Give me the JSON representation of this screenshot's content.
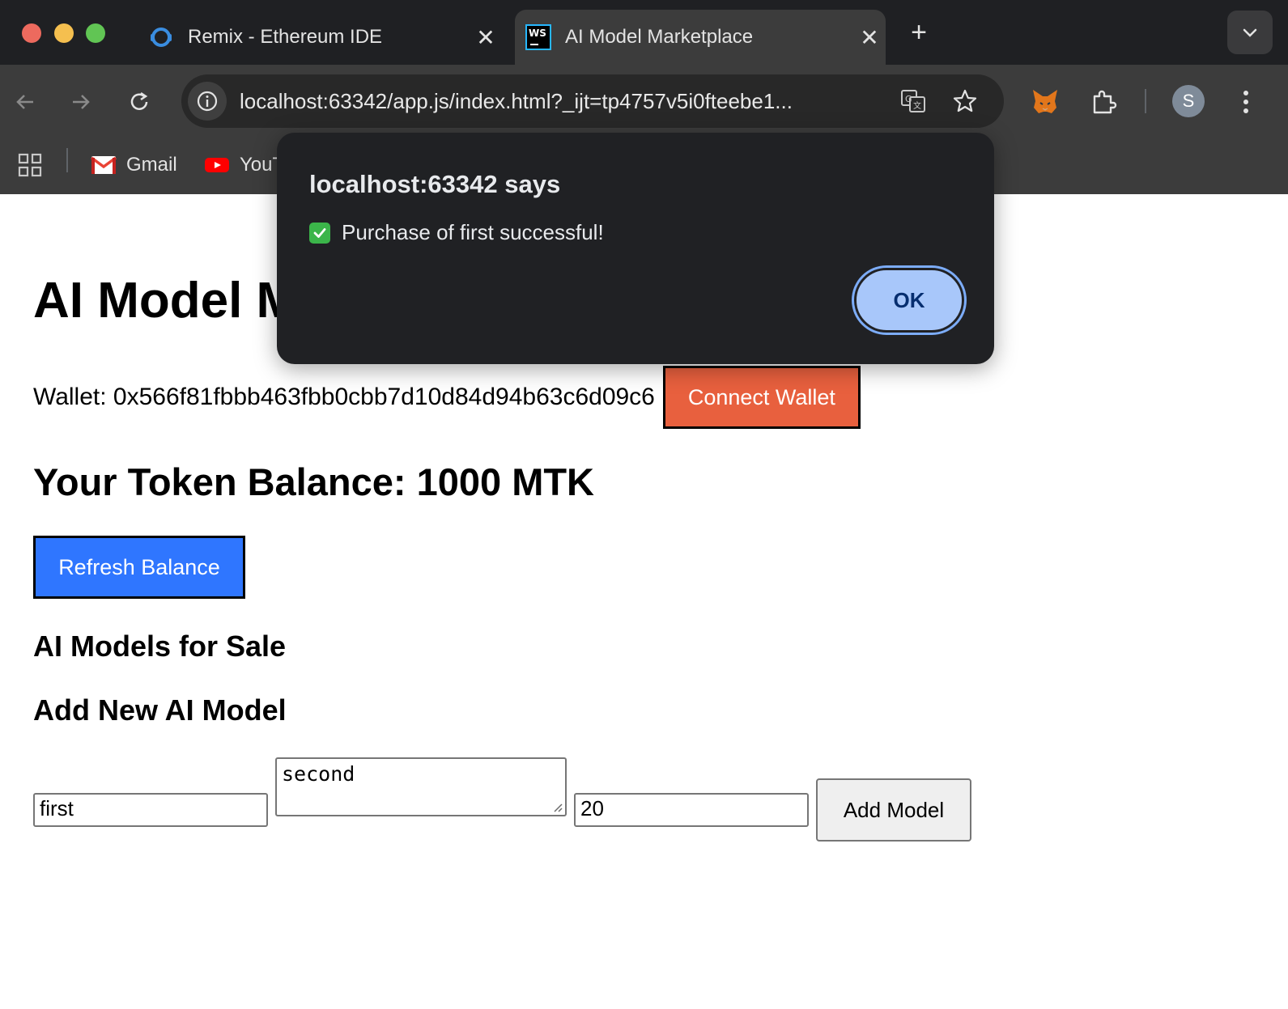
{
  "browser": {
    "tabs": [
      {
        "title": "Remix - Ethereum IDE",
        "icon": "remix-icon",
        "active": false
      },
      {
        "title": "AI Model Marketplace",
        "icon": "webstorm-icon",
        "active": true
      }
    ],
    "new_tab": "+",
    "url": "localhost:63342/app.js/index.html?_ijt=tp4757v5i0fteebe1...",
    "profile_initial": "S",
    "bookmarks": [
      {
        "label": "Gmail",
        "icon": "gmail-icon"
      },
      {
        "label": "YouT",
        "icon": "youtube-icon"
      }
    ]
  },
  "dialog": {
    "title": "localhost:63342 says",
    "message": "Purchase of first successful!",
    "ok_label": "OK"
  },
  "page": {
    "title": "AI Model Marketplace",
    "wallet_text": "Wallet: 0x566f81fbbb463fbb0cbb7d10d84d94b63c6d09c6",
    "connect_label": "Connect Wallet",
    "balance_text": "Your Token Balance: 1000 MTK",
    "refresh_label": "Refresh Balance",
    "models_heading": "AI Models for Sale",
    "add_heading": "Add New AI Model",
    "form": {
      "name_value": "first",
      "description_value": "second",
      "price_value": "20",
      "add_label": "Add Model"
    }
  },
  "colors": {
    "connect_button": "#e8603e",
    "refresh_button": "#2f76ff",
    "dialog_bg": "#202124",
    "ok_button": "#a8c7fa"
  }
}
